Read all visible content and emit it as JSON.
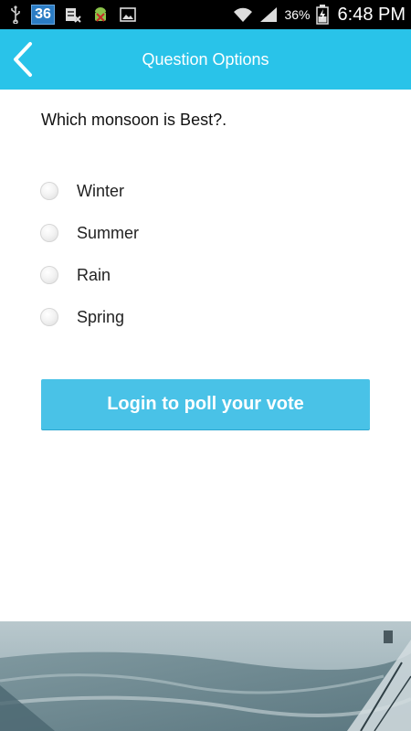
{
  "status_bar": {
    "notification_badge": "36",
    "battery_percent": "36%",
    "time": "6:48 PM",
    "icons": [
      "usb-icon",
      "calendar-badge-icon",
      "sim-error-icon",
      "android-debug-icon",
      "image-icon",
      "wifi-icon",
      "signal-icon",
      "battery-charging-icon"
    ]
  },
  "header": {
    "title": "Question Options",
    "back_icon": "chevron-left-icon",
    "color": "#29c3e9"
  },
  "question": "Which monsoon is Best?.",
  "options": [
    "Winter",
    "Summer",
    "Rain",
    "Spring"
  ],
  "login_button": {
    "label": "Login to poll your vote",
    "color": "#49c2e7"
  }
}
